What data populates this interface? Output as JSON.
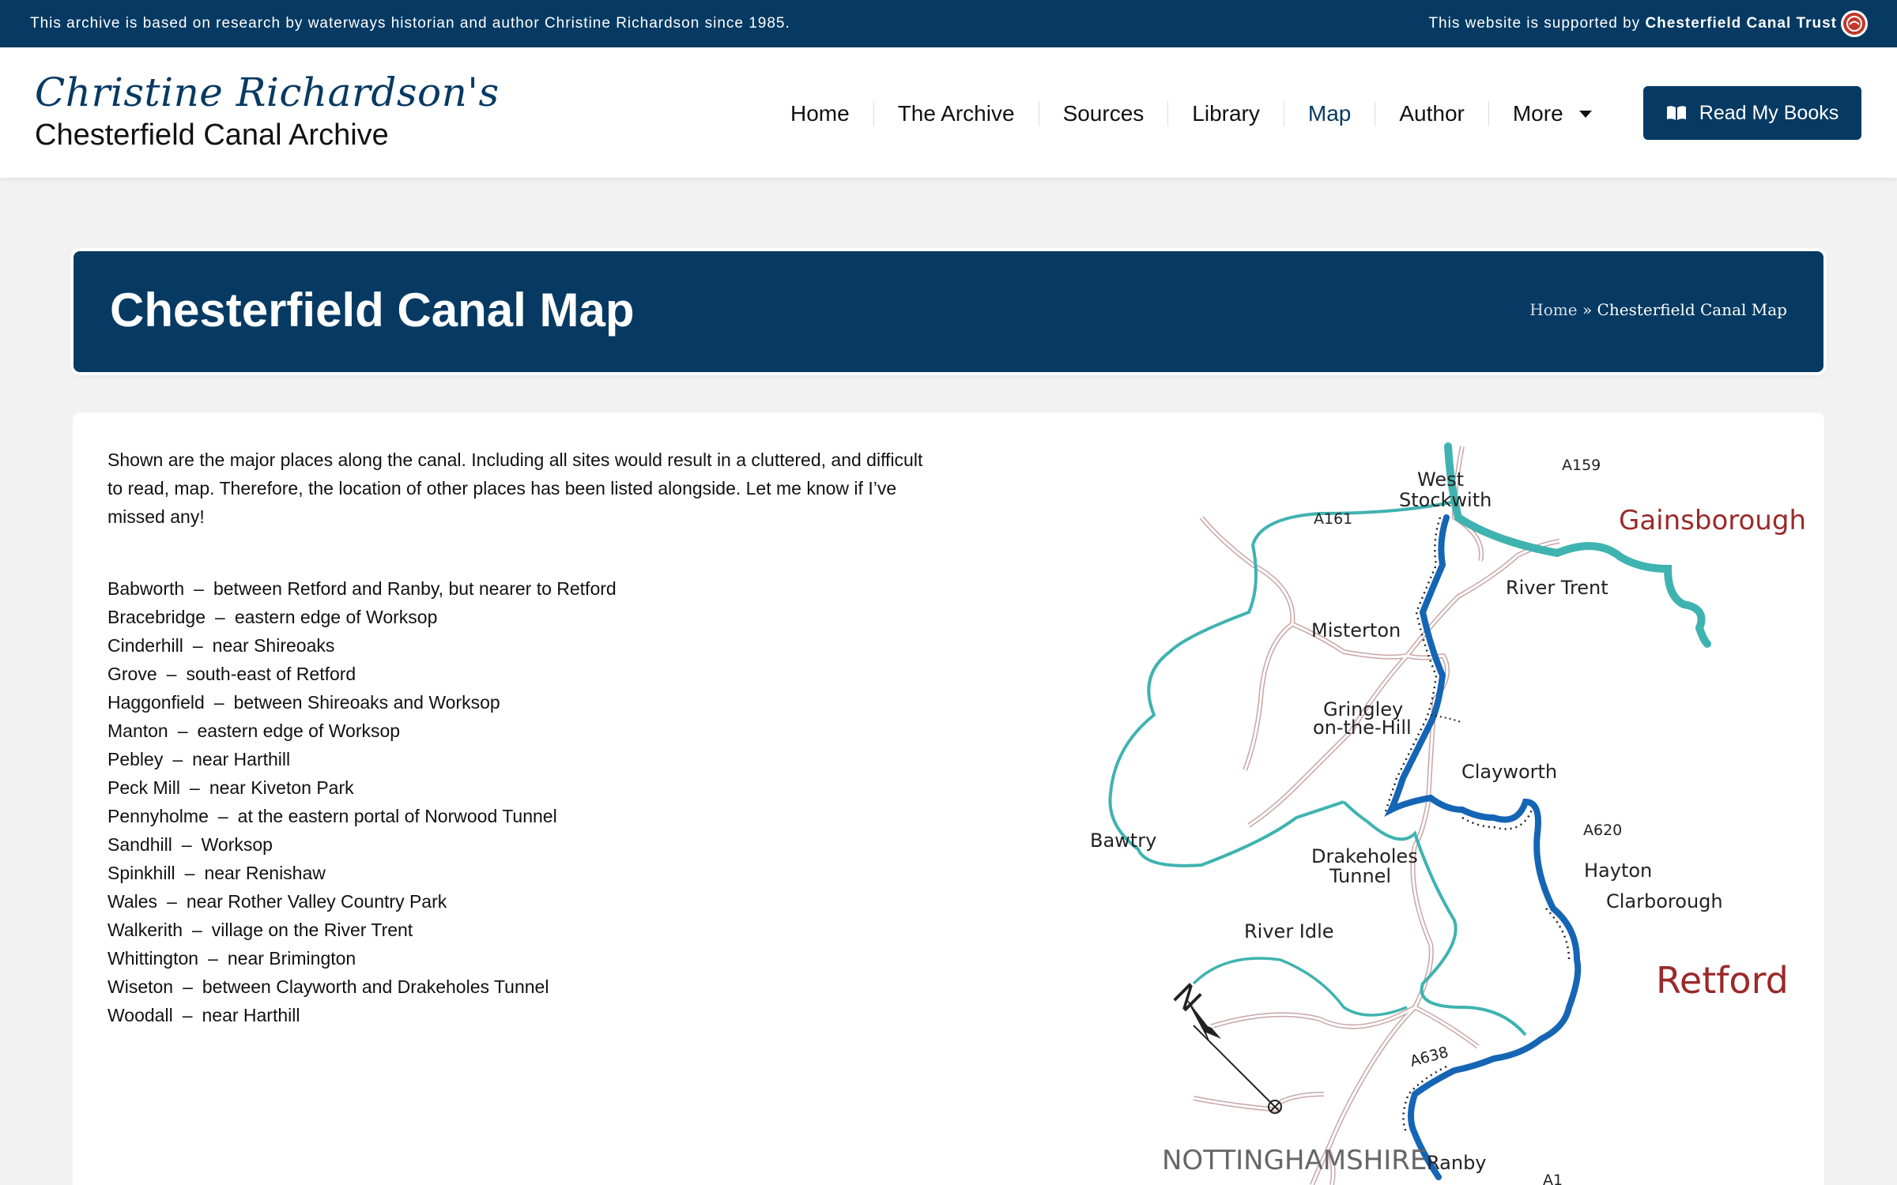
{
  "topbar": {
    "left_text": "This archive is based on research by waterways historian and author Christine Richardson since 1985.",
    "right_text": "This website is supported by",
    "right_strong": "Chesterfield Canal Trust"
  },
  "logo": {
    "script": "Christine Richardson's",
    "subtitle": "Chesterfield Canal Archive"
  },
  "nav": {
    "items": [
      "Home",
      "The Archive",
      "Sources",
      "Library",
      "Map",
      "Author"
    ],
    "more_label": "More",
    "active": "Map"
  },
  "books_button": {
    "label": "Read My Books",
    "icon": "open-book-icon"
  },
  "page_title": "Chesterfield Canal Map",
  "breadcrumb": {
    "home": "Home",
    "separator": "»",
    "current": "Chesterfield Canal Map"
  },
  "intro": "Shown are the major places along the canal.  Including all sites would result in a cluttered, and difficult to read, map.  Therefore, the location of other places has been listed alongside.  Let me know if I’ve missed any!",
  "places": [
    {
      "name": "Babworth",
      "desc": "between Retford and Ranby, but nearer to Retford"
    },
    {
      "name": "Bracebridge",
      "desc": "eastern edge of Worksop"
    },
    {
      "name": "Cinderhill",
      "desc": "near Shireoaks"
    },
    {
      "name": "Grove",
      "desc": "south-east of Retford"
    },
    {
      "name": "Haggonfield",
      "desc": "between Shireoaks and Worksop"
    },
    {
      "name": "Manton",
      "desc": "eastern edge of Worksop"
    },
    {
      "name": "Pebley",
      "desc": "near Harthill"
    },
    {
      "name": "Peck Mill",
      "desc": "near Kiveton Park"
    },
    {
      "name": "Pennyholme",
      "desc": "at the eastern portal of Norwood Tunnel"
    },
    {
      "name": "Sandhill",
      "desc": "Worksop"
    },
    {
      "name": "Spinkhill",
      "desc": "near Renishaw"
    },
    {
      "name": "Wales",
      "desc": "near Rother Valley Country Park"
    },
    {
      "name": "Walkerith",
      "desc": "village on the River Trent"
    },
    {
      "name": "Whittington",
      "desc": "near Brimington"
    },
    {
      "name": "Wiseton",
      "desc": "between Clayworth and Drakeholes Tunnel"
    },
    {
      "name": "Woodall",
      "desc": "near Harthill"
    }
  ],
  "place_separator": "–",
  "map": {
    "labels": {
      "west_stockwith_1": "West",
      "west_stockwith_2": "Stockwith",
      "a159": "A159",
      "a161": "A161",
      "gainsborough": "Gainsborough",
      "river_trent": "River Trent",
      "misterton": "Misterton",
      "gringley_1": "Gringley",
      "gringley_2": "on-the-Hill",
      "clayworth": "Clayworth",
      "bawtry": "Bawtry",
      "drakeholes_1": "Drakeholes",
      "drakeholes_2": "Tunnel",
      "a620": "A620",
      "hayton": "Hayton",
      "clarborough": "Clarborough",
      "river_idle": "River Idle",
      "retford": "Retford",
      "a638": "A638",
      "north": "N",
      "county": "NOTTINGHAMSHIRE",
      "ranby": "Ranby",
      "a1": "A1"
    },
    "colors": {
      "canal": "#1565b5",
      "river": "#3fb3b0",
      "road": "#c9a5a5",
      "town_major": "#9a2a2a"
    }
  }
}
